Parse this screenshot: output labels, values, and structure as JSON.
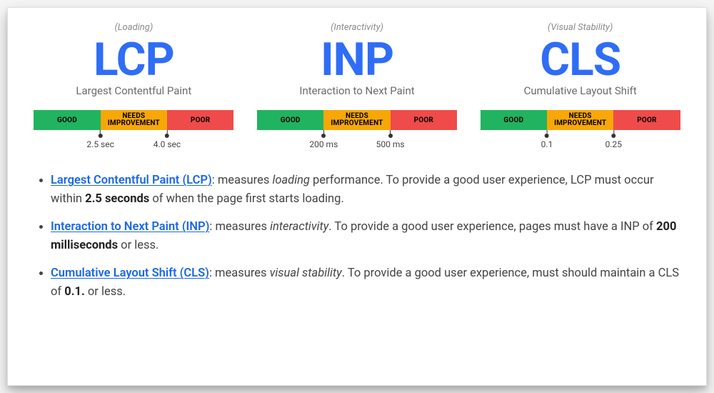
{
  "metrics": [
    {
      "category": "(Loading)",
      "acronym": "LCP",
      "fullname": "Largest Contentful Paint",
      "seg_good": "GOOD",
      "seg_needs": "NEEDS\nIMPROVEMENT",
      "seg_poor": "POOR",
      "threshold1": "2.5 sec",
      "threshold2": "4.0 sec"
    },
    {
      "category": "(Interactivity)",
      "acronym": "INP",
      "fullname": "Interaction to Next Paint",
      "seg_good": "GOOD",
      "seg_needs": "NEEDS\nIMPROVEMENT",
      "seg_poor": "POOR",
      "threshold1": "200 ms",
      "threshold2": "500 ms"
    },
    {
      "category": "(Visual Stability)",
      "acronym": "CLS",
      "fullname": "Cumulative Layout Shift",
      "seg_good": "GOOD",
      "seg_needs": "NEEDS\nIMPROVEMENT",
      "seg_poor": "POOR",
      "threshold1": "0.1",
      "threshold2": "0.25"
    }
  ],
  "descriptions": [
    {
      "term": "Largest Contentful Paint (LCP)",
      "pre": ": measures ",
      "emph": "loading",
      "mid": " performance. To provide a good user experience, LCP must occur within ",
      "bold": "2.5 seconds",
      "post": " of when the page first starts loading."
    },
    {
      "term": "Interaction to Next Paint (INP)",
      "pre": ": measures ",
      "emph": "interactivity",
      "mid": ". To provide a good user experience, pages must have a INP of ",
      "bold": "200 milliseconds",
      "post": " or less."
    },
    {
      "term": "Cumulative Layout Shift (CLS)",
      "pre": ": measures ",
      "emph": "visual stability",
      "mid": ". To provide a good user experience, must should maintain a CLS of ",
      "bold": "0.1.",
      "post": " or less."
    }
  ]
}
